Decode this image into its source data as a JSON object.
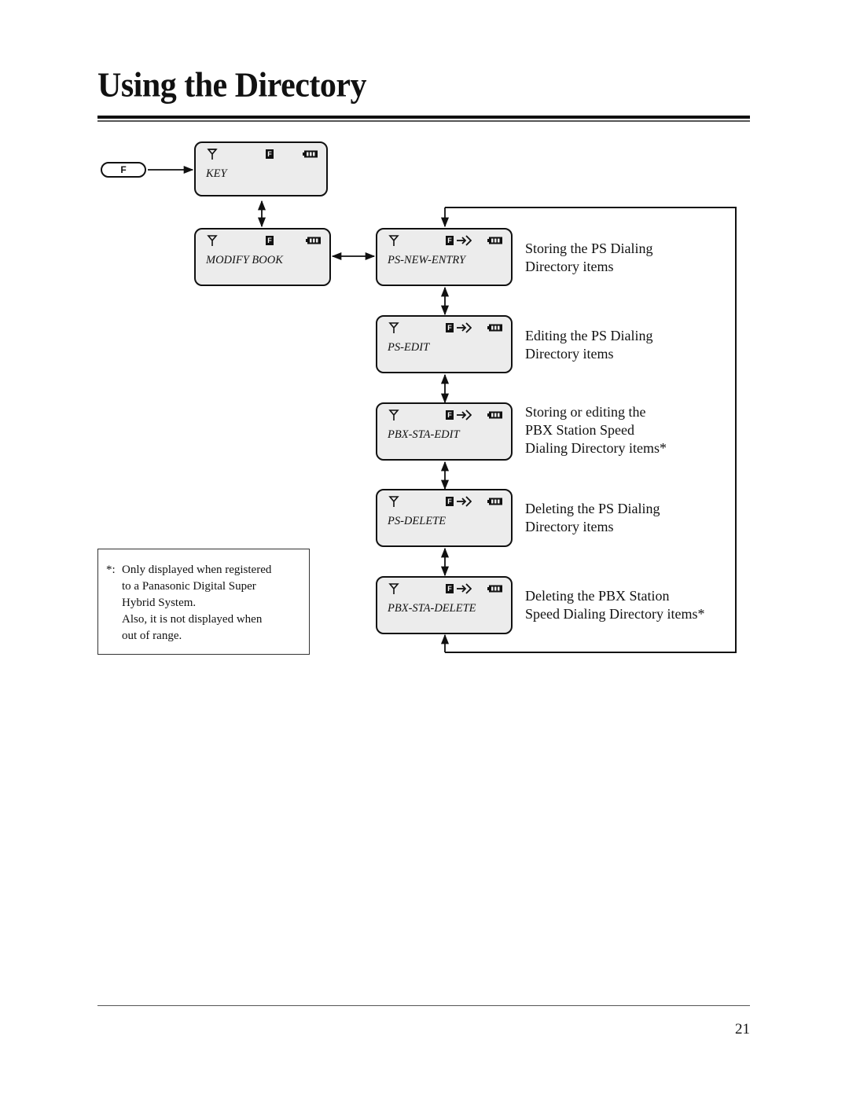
{
  "page": {
    "title": "Using the Directory",
    "page_number": "21"
  },
  "key_button": {
    "label": "F",
    "icon": "function-key"
  },
  "status_icons": {
    "antenna": "antenna-icon",
    "function": "F",
    "arrow_in": "arrow-in-icon",
    "battery": "battery-icon"
  },
  "displays": [
    {
      "id": "key",
      "label": "KEY"
    },
    {
      "id": "modify-book",
      "label": "MODIFY BOOK"
    },
    {
      "id": "ps-new-entry",
      "label": "PS-NEW-ENTRY"
    },
    {
      "id": "ps-edit",
      "label": "PS-EDIT"
    },
    {
      "id": "pbx-sta-edit",
      "label": "PBX-STA-EDIT"
    },
    {
      "id": "ps-delete",
      "label": "PS-DELETE"
    },
    {
      "id": "pbx-sta-delete",
      "label": "PBX-STA-DELETE"
    }
  ],
  "descriptions": [
    {
      "lines": [
        "Storing the PS Dialing",
        "Directory items"
      ]
    },
    {
      "lines": [
        "Editing the PS Dialing",
        "Directory items"
      ]
    },
    {
      "lines": [
        "Storing or editing the",
        "PBX Station Speed",
        "Dialing Directory items*"
      ]
    },
    {
      "lines": [
        "Deleting the PS Dialing",
        "Directory items"
      ]
    },
    {
      "lines": [
        "Deleting the PBX Station",
        "Speed Dialing Directory items*"
      ]
    }
  ],
  "note": {
    "mark": "*:",
    "lines": [
      "Only displayed when registered",
      "to a Panasonic Digital Super",
      "Hybrid System.",
      "Also, it is not displayed when",
      "out of range."
    ]
  }
}
